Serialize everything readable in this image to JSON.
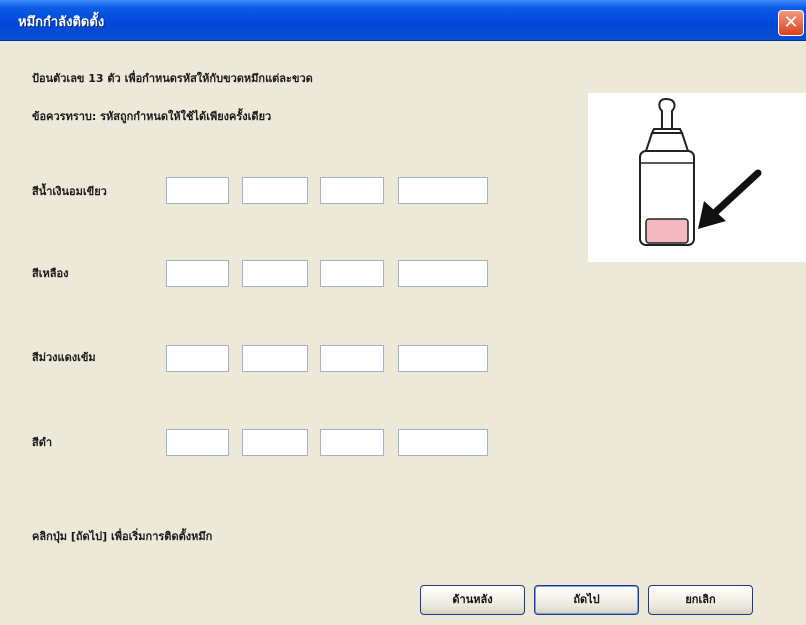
{
  "window": {
    "title": "หมึกกำลังติดตั้ง"
  },
  "instructions": {
    "line1": "ป้อนตัวเลข 13 ตัว เพื่อกำหนดรหัสให้กับขวดหมึกแต่ละขวด",
    "line2": "ข้อควรทราบ: รหัสถูกกำหนดให้ใช้ได้เพียงครั้งเดียว"
  },
  "colors": [
    {
      "label": "สีน้ำเงินอมเขียว",
      "fields": [
        "",
        "",
        "",
        ""
      ]
    },
    {
      "label": "สีเหลือง",
      "fields": [
        "",
        "",
        "",
        ""
      ]
    },
    {
      "label": "สีม่วงแดงเข้ม",
      "fields": [
        "",
        "",
        "",
        ""
      ]
    },
    {
      "label": "สีดำ",
      "fields": [
        "",
        "",
        "",
        ""
      ]
    }
  ],
  "footer": {
    "text": "คลิกปุ่ม [ถัดไป] เพื่อเริ่มการติดตั้งหมึก"
  },
  "buttons": {
    "back": "ด้านหลัง",
    "next": "ถัดไป",
    "cancel": "ยกเลิก"
  },
  "icons": {
    "close": "close-icon",
    "illustration": "ink-bottle-code-illustration"
  },
  "theme": {
    "titlebar": "#0a50d8",
    "close": "#e2552e",
    "background": "#ece9d8",
    "label_pink": "#f3b8c0"
  }
}
